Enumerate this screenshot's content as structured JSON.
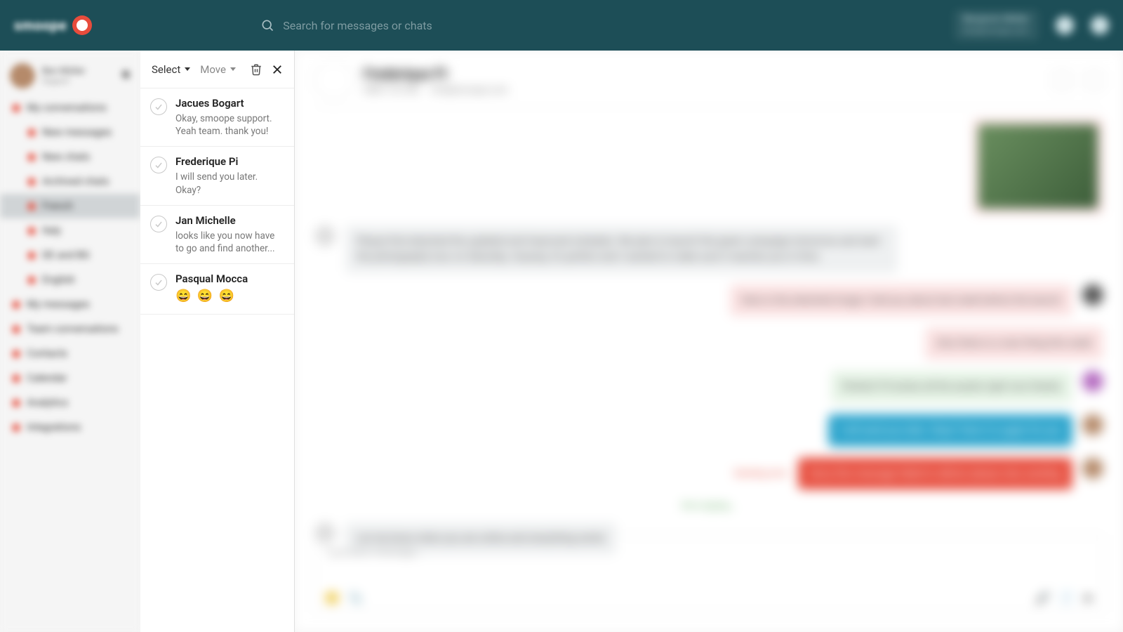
{
  "brand": "smoope",
  "search": {
    "placeholder": "Search for messages or chats"
  },
  "header_user": {
    "line1": "Benjamin Müller",
    "line2": "ben@smoope.com"
  },
  "sidebar": {
    "user": {
      "name": "Ben Müller",
      "sub": "Support"
    },
    "items": [
      {
        "label": "My conversations",
        "indent": false
      },
      {
        "label": "New messages",
        "indent": true
      },
      {
        "label": "New chats",
        "indent": true
      },
      {
        "label": "Archived chats",
        "indent": true
      },
      {
        "label": "French",
        "indent": true,
        "active": true
      },
      {
        "label": "Italy",
        "indent": true
      },
      {
        "label": "DE and BG",
        "indent": true
      },
      {
        "label": "English",
        "indent": true
      },
      {
        "label": "My messages",
        "indent": false
      },
      {
        "label": "Team conversations",
        "indent": false
      },
      {
        "label": "Contacts",
        "indent": false
      },
      {
        "label": "Calendar",
        "indent": false
      },
      {
        "label": "Analytics",
        "indent": false
      },
      {
        "label": "Integrations",
        "indent": false
      }
    ]
  },
  "toolbar": {
    "select": "Select",
    "move": "Move"
  },
  "conversations": [
    {
      "name": "Jacues Bogart",
      "preview": "Okay, smoope support. Yeah team. thank you!"
    },
    {
      "name": "Frederique Pi",
      "preview": "I will send you later. Okay?"
    },
    {
      "name": "Jan Michelle",
      "preview": "looks like you now have to go and find another..."
    },
    {
      "name": "Pasqual Mocca",
      "preview": "😄 😄 😄",
      "emoji": true
    }
  ],
  "chat": {
    "title": "Frederique Pi",
    "phone": "0800 123 456",
    "email": "info@smoope.com",
    "incoming_long": "Please find attached the updated and improved schedule. We plan to launch the green campaign tomorrow and start the photography tour on Saturday. Anyway, it's perfect and I wanted to make sure it reaches you in time.",
    "pink1": "Image aligned to the right side of the chat window",
    "pink2": "Here is the attached image I told you about last week before the launch",
    "pink3": "Also there is a new thing this week",
    "green1": "Perfect! I'll review all the assets right now thanks",
    "blue1": "I will send you later. Okay? Here it is again for you",
    "red1": "Sorry this message failed to deliver please retry sending",
    "red_label": "Sending error",
    "note": "Let me know when you are online and everything works",
    "typing": "He is typing...",
    "compose_placeholder": "Type your message..."
  }
}
